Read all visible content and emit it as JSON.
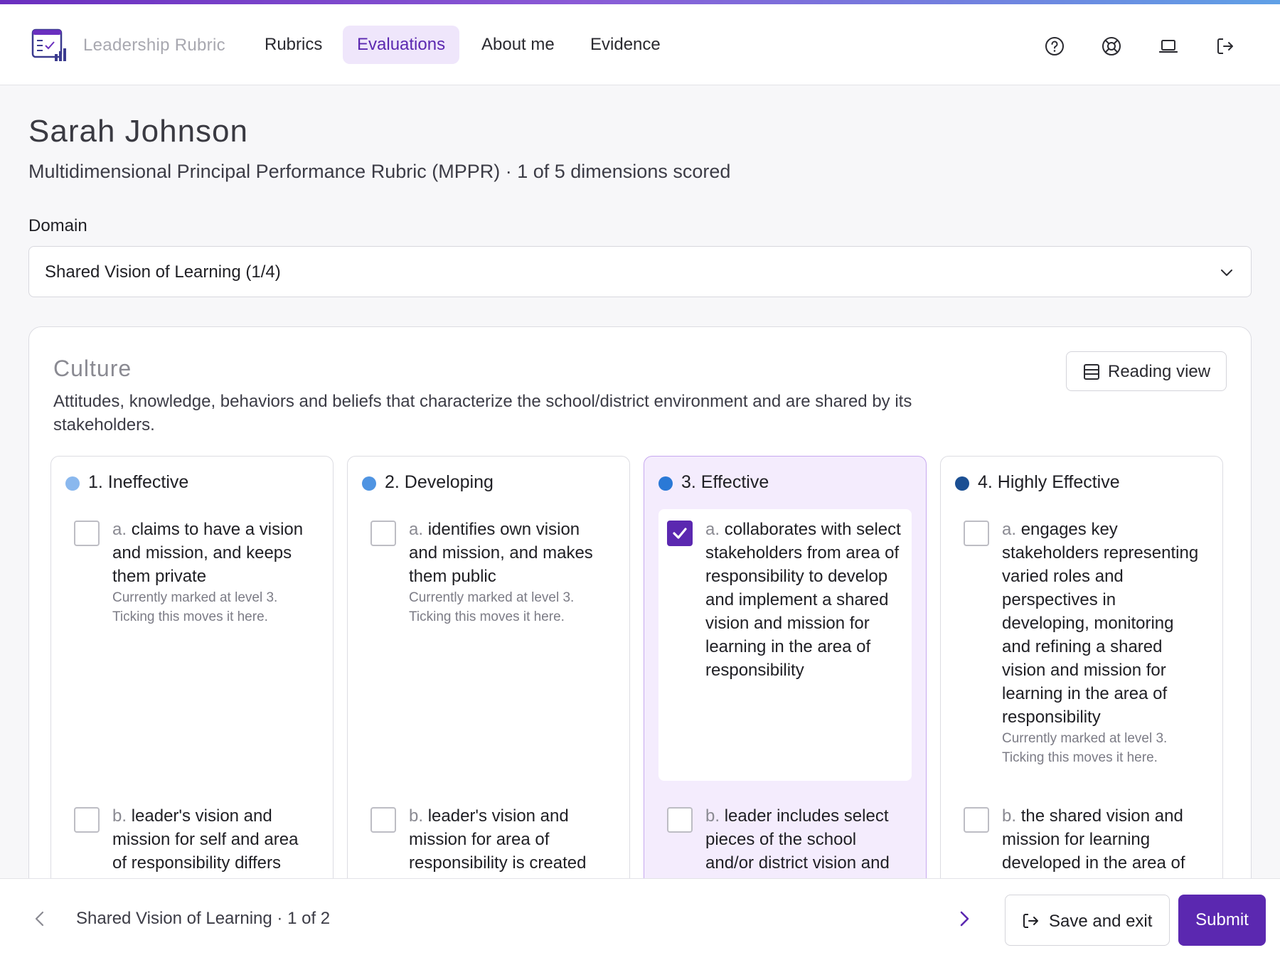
{
  "brand": {
    "name": "Leadership Rubric"
  },
  "nav": [
    {
      "label": "Rubrics",
      "active": false
    },
    {
      "label": "Evaluations",
      "active": true
    },
    {
      "label": "About me",
      "active": false
    },
    {
      "label": "Evidence",
      "active": false
    }
  ],
  "header_icons": [
    "help-icon",
    "support-icon",
    "laptop-icon",
    "logout-icon"
  ],
  "evaluation": {
    "person": "Sarah Johnson",
    "subtitle": "Multidimensional Principal Performance Rubric (MPPR) · 1 of 5 dimensions scored"
  },
  "domain": {
    "label": "Domain",
    "selected": "Shared Vision of Learning (1/4)"
  },
  "dimension": {
    "title": "Culture",
    "description": "Attitudes, knowledge, behaviors and beliefs that characterize the school/district environment and are shared by its stakeholders.",
    "reading_view_label": "Reading view",
    "levels": [
      {
        "heading": "1. Ineffective",
        "dot_color": "#8ab8ee",
        "items": [
          {
            "letter": "a.",
            "text": "claims to have a vision and mission, and keeps them private",
            "checked": false,
            "note1": "Currently marked at level 3.",
            "note2": "Ticking this moves it here."
          },
          {
            "letter": "b.",
            "text": "leader's vision and mission for self and area of responsibility differs",
            "checked": false
          }
        ]
      },
      {
        "heading": "2. Developing",
        "dot_color": "#4f94e2",
        "items": [
          {
            "letter": "a.",
            "text": "identifies own vision and mission, and makes them public",
            "checked": false,
            "note1": "Currently marked at level 3.",
            "note2": "Ticking this moves it here."
          },
          {
            "letter": "b.",
            "text": "leader's vision and mission for area of responsibility is created",
            "checked": false
          }
        ]
      },
      {
        "heading": "3. Effective",
        "dot_color": "#2a79d6",
        "selected": true,
        "items": [
          {
            "letter": "a.",
            "text": "collaborates with select stakeholders from area of responsibility to develop and implement a shared vision and mission for learning in the area of responsibility",
            "checked": true
          },
          {
            "letter": "b.",
            "text": "leader includes select pieces of the school and/or district vision and",
            "checked": false
          }
        ]
      },
      {
        "heading": "4. Highly Effective",
        "dot_color": "#1b4f93",
        "items": [
          {
            "letter": "a.",
            "text": "engages key stakeholders representing varied roles and perspectives in developing, monitoring and refining a shared vision and mission for learning in the area of responsibility",
            "checked": false,
            "note1": "Currently marked at level 3.",
            "note2": "Ticking this moves it here."
          },
          {
            "letter": "b.",
            "text": "the shared vision and mission for learning developed in the area of",
            "checked": false
          }
        ]
      }
    ]
  },
  "footer": {
    "progress_label": "Shared Vision of Learning · 1 of 2",
    "save_label": "Save and exit",
    "submit_label": "Submit"
  },
  "colors": {
    "accent": "#5b28b0",
    "accent_bg": "#efe6fb",
    "selected_col_bg": "#f4ecfd"
  }
}
